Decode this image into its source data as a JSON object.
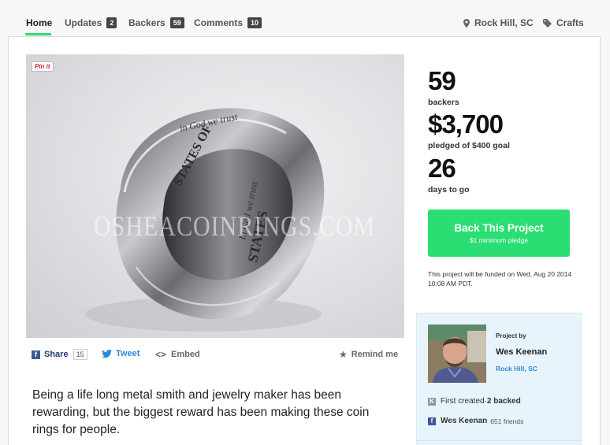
{
  "nav": {
    "home": "Home",
    "updates": {
      "label": "Updates",
      "count": "2"
    },
    "backers": {
      "label": "Backers",
      "count": "59"
    },
    "comments": {
      "label": "Comments",
      "count": "10"
    },
    "location": "Rock Hill, SC",
    "category": "Crafts",
    "accent_color": "#2bde73"
  },
  "media": {
    "pinit_label": "Pin it",
    "watermark": "OSHEACOINRINGS.COM",
    "description": "silver coin ring engraved 'In God we trust' and 'United States of America'"
  },
  "share": {
    "share_label": "Share",
    "share_count": "15",
    "tweet_label": "Tweet",
    "embed_label": "Embed",
    "remind_label": "Remind me"
  },
  "description": "Being a life long metal smith and jewelry maker has been rewarding, but the biggest reward has been making these coin rings for people.",
  "stats": {
    "backers_count": "59",
    "backers_label": "backers",
    "pledged": "$3,700",
    "pledged_label": "pledged of $400 goal",
    "days": "26",
    "days_label": "days to go"
  },
  "back_button": {
    "label": "Back This Project",
    "sublabel": "$1 minimum pledge",
    "color": "#2bde73"
  },
  "funded_note": "This project will be funded on Wed, Aug 20 2014 10:08 AM PDT.",
  "creator": {
    "by_label": "Project by",
    "name": "Wes Keenan",
    "location": "Rock Hill, SC",
    "ks_prefix": "First created",
    "ks_sep": " · ",
    "backed": "2 backed",
    "fb_name": "Wes Keenan",
    "fb_friends": "651 friends"
  }
}
